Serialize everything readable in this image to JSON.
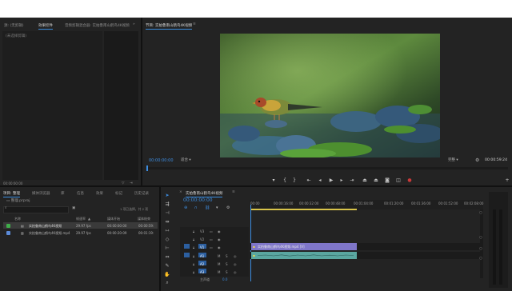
{
  "source_panel": {
    "tabs": [
      "源: (无剪辑)",
      "效果控件",
      "音频剪辑混合器: 实拍鲁南山鹤鸟4K视频"
    ],
    "no_clip_label": "(未选择剪辑)",
    "timecode": "00:00:00:00"
  },
  "program_panel": {
    "tab": "节目: 实拍鲁南山鹤鸟4K视频",
    "timecode": "00:00:00:00",
    "fit_label": "适合",
    "quality_label": "完整",
    "duration": "00:00:59:24"
  },
  "project_panel": {
    "tabs": [
      "项目: 整理",
      "媒体浏览器",
      "库",
      "信息",
      "效果",
      "标记",
      "历史记录"
    ],
    "project_file": "整理.prproj",
    "selection_info": "1 项已选择，共 2 项",
    "columns": [
      "名称",
      "帧速率",
      "媒体开始",
      "媒体结束"
    ],
    "rows": [
      {
        "name": "实拍鲁南山鹤鸟4K视频",
        "fps": "29.97 fps",
        "start": "00:00:00:00",
        "end": "00:00:59:",
        "color": "#3fae4a"
      },
      {
        "name": "实拍鲁南山鹤鸟4K视频.mp4",
        "fps": "29.97 fps",
        "start": "00:00:20:09",
        "end": "00:01:19:",
        "color": "#5b8ad8"
      }
    ]
  },
  "timeline": {
    "tab": "实拍鲁南山鹤鸟4K视频",
    "timecode": "00:00:00:00",
    "ruler": [
      "00:00",
      "00:00:16:00",
      "00:00:32:00",
      "00:00:48:00",
      "00:01:04:00",
      "00:01:20:00",
      "00:01:36:00",
      "00:01:52:00",
      "00:02:08:00"
    ],
    "video_tracks": [
      "V3",
      "V2",
      "V1"
    ],
    "audio_tracks": [
      "A1",
      "A2",
      "A3"
    ],
    "mix_label": "主声道",
    "mix_value": "0.0",
    "clip_video": "实拍鲁南山鹤鸟4K视频.mp4 [V]",
    "clip_audio": ""
  },
  "colors": {
    "accent": "#3d8de0",
    "clip_video": "#7f76c9",
    "clip_audio": "#5aa6a0",
    "playhead": "#3d8de0"
  }
}
